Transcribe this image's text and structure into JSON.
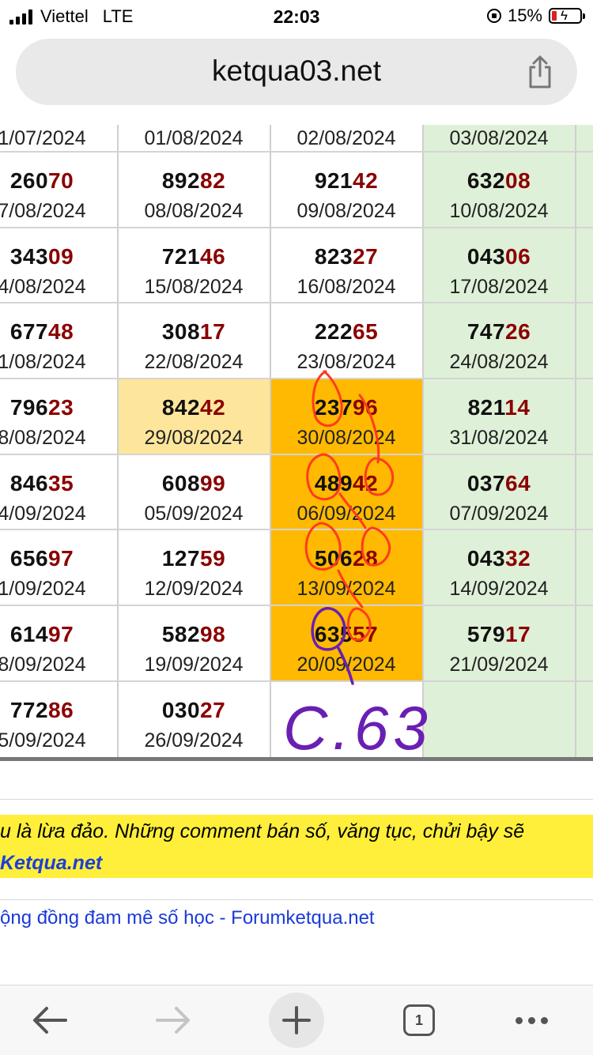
{
  "status_bar": {
    "carrier": "Viettel",
    "network": "LTE",
    "time": "22:03",
    "battery": "15%"
  },
  "browser": {
    "url": "ketqua03.net",
    "tab_count": "1"
  },
  "table": {
    "rows": [
      [
        {
          "head": "",
          "tail": "",
          "date": "1/07/2024"
        },
        {
          "head": "",
          "tail": "",
          "date": "01/08/2024"
        },
        {
          "head": "",
          "tail": "",
          "date": "02/08/2024"
        },
        {
          "head": "",
          "tail": "",
          "date": "03/08/2024"
        }
      ],
      [
        {
          "head": "260",
          "tail": "70",
          "date": "7/08/2024"
        },
        {
          "head": "892",
          "tail": "82",
          "date": "08/08/2024"
        },
        {
          "head": "921",
          "tail": "42",
          "date": "09/08/2024"
        },
        {
          "head": "632",
          "tail": "08",
          "date": "10/08/2024"
        }
      ],
      [
        {
          "head": "343",
          "tail": "09",
          "date": "4/08/2024"
        },
        {
          "head": "721",
          "tail": "46",
          "date": "15/08/2024"
        },
        {
          "head": "823",
          "tail": "27",
          "date": "16/08/2024"
        },
        {
          "head": "043",
          "tail": "06",
          "date": "17/08/2024"
        }
      ],
      [
        {
          "head": "677",
          "tail": "48",
          "date": "1/08/2024"
        },
        {
          "head": "308",
          "tail": "17",
          "date": "22/08/2024"
        },
        {
          "head": "222",
          "tail": "65",
          "date": "23/08/2024"
        },
        {
          "head": "747",
          "tail": "26",
          "date": "24/08/2024"
        }
      ],
      [
        {
          "head": "796",
          "tail": "23",
          "date": "8/08/2024"
        },
        {
          "head": "842",
          "tail": "42",
          "date": "29/08/2024"
        },
        {
          "head": "237",
          "tail": "96",
          "date": "30/08/2024"
        },
        {
          "head": "821",
          "tail": "14",
          "date": "31/08/2024"
        }
      ],
      [
        {
          "head": "846",
          "tail": "35",
          "date": "4/09/2024"
        },
        {
          "head": "608",
          "tail": "99",
          "date": "05/09/2024"
        },
        {
          "head": "489",
          "tail": "42",
          "date": "06/09/2024"
        },
        {
          "head": "037",
          "tail": "64",
          "date": "07/09/2024"
        }
      ],
      [
        {
          "head": "656",
          "tail": "97",
          "date": "1/09/2024"
        },
        {
          "head": "127",
          "tail": "59",
          "date": "12/09/2024"
        },
        {
          "head": "506",
          "tail": "28",
          "date": "13/09/2024"
        },
        {
          "head": "043",
          "tail": "32",
          "date": "14/09/2024"
        }
      ],
      [
        {
          "head": "614",
          "tail": "97",
          "date": "8/09/2024"
        },
        {
          "head": "582",
          "tail": "98",
          "date": "19/09/2024"
        },
        {
          "head": "635",
          "tail": "57",
          "date": "20/09/2024"
        },
        {
          "head": "579",
          "tail": "17",
          "date": "21/09/2024"
        }
      ],
      [
        {
          "head": "772",
          "tail": "86",
          "date": "5/09/2024"
        },
        {
          "head": "030",
          "tail": "27",
          "date": "26/09/2024"
        },
        {
          "head": "",
          "tail": "",
          "date": ""
        },
        {
          "head": "",
          "tail": "",
          "date": ""
        }
      ]
    ]
  },
  "annotation": {
    "handwritten_text": "C.63"
  },
  "notice": {
    "text": "u là lừa đảo. Những comment bán số, văng tục, chửi bậy sẽ",
    "link": "Ketqua.net"
  },
  "footer_link": "ộng đồng đam mê số học - Forumketqua.net",
  "colors": {
    "green_column": "#dff0d8",
    "highlight_orange": "#ffb900",
    "highlight_light": "#fde69c",
    "number_tail": "#8b0000",
    "notice_bg": "#ffef3a",
    "link_blue": "#1c3fd6",
    "pen_red": "#ff3b1f",
    "pen_purple": "#6a1fb3"
  }
}
